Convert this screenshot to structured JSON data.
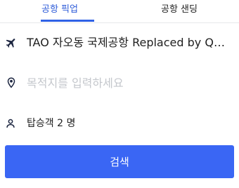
{
  "tabs": [
    {
      "label": "공항 픽업",
      "active": true
    },
    {
      "label": "공항 샌딩",
      "active": false
    }
  ],
  "trip": {
    "pickup_location": "TAO 자오동 국제공항 Replaced by Qingdao Jiaodong International Airport",
    "pickup_icon": "airplane-icon",
    "destination": {
      "value": "",
      "placeholder": "목적지를 입력하세요",
      "icon": "location-pin-icon"
    },
    "passengers": {
      "text": "탑승객 2 명",
      "icon": "person-icon"
    }
  },
  "search_button": {
    "label": "검색"
  },
  "colors": {
    "accent": "#3a66f4",
    "tab_active_text": "#2d5bd8",
    "placeholder": "#c4c7cc",
    "icon": "#1c2540"
  }
}
